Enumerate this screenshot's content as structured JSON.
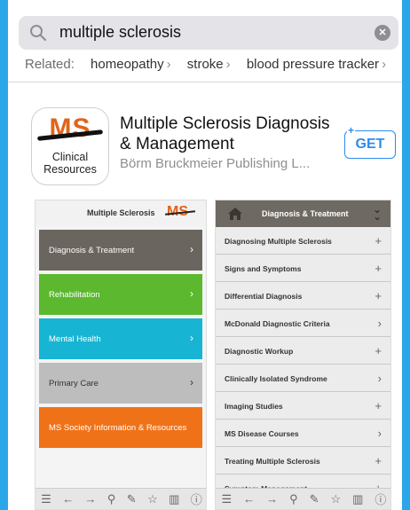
{
  "search": {
    "query": "multiple sclerosis"
  },
  "related": {
    "label": "Related:",
    "items": [
      "homeopathy",
      "stroke",
      "blood pressure tracker"
    ]
  },
  "app": {
    "icon_logo": "MS",
    "icon_line1": "Clinical",
    "icon_line2": "Resources",
    "title_line1": "Multiple Sclerosis Diagnosis",
    "title_line2": "& Management",
    "developer": "Börm Bruckmeier Publishing L...",
    "get_label": "GET",
    "get_plus": "+"
  },
  "screenshot1": {
    "header_title": "Multiple Sclerosis",
    "header_logo": "MS",
    "menu": [
      {
        "label": "Diagnosis & Treatment",
        "color": "#6b655f"
      },
      {
        "label": "Rehabilitation",
        "color": "#5cb82f"
      },
      {
        "label": "Mental Health",
        "color": "#18b4d3"
      },
      {
        "label": "Primary Care",
        "color": "#bdbdbd"
      },
      {
        "label": "MS Society Information & Resources",
        "color": "#f07218"
      }
    ]
  },
  "screenshot2": {
    "header_title": "Diagnosis & Treatment",
    "rows": [
      {
        "label": "Diagnosing Multiple Sclerosis",
        "sym": "+"
      },
      {
        "label": "Signs and Symptoms",
        "sym": "+"
      },
      {
        "label": "Differential Diagnosis",
        "sym": "+"
      },
      {
        "label": "McDonald Diagnostic Criteria",
        "sym": "›"
      },
      {
        "label": "Diagnostic Workup",
        "sym": "+"
      },
      {
        "label": "Clinically Isolated Syndrome",
        "sym": "›"
      },
      {
        "label": "Imaging Studies",
        "sym": "+"
      },
      {
        "label": "MS Disease Courses",
        "sym": "›"
      },
      {
        "label": "Treating Multiple Sclerosis",
        "sym": "+"
      },
      {
        "label": "Symptom Management",
        "sym": "+"
      }
    ]
  },
  "colors": {
    "accent": "#2d8cf0",
    "background": "#2aa7e8",
    "ms_orange": "#e0641a"
  }
}
